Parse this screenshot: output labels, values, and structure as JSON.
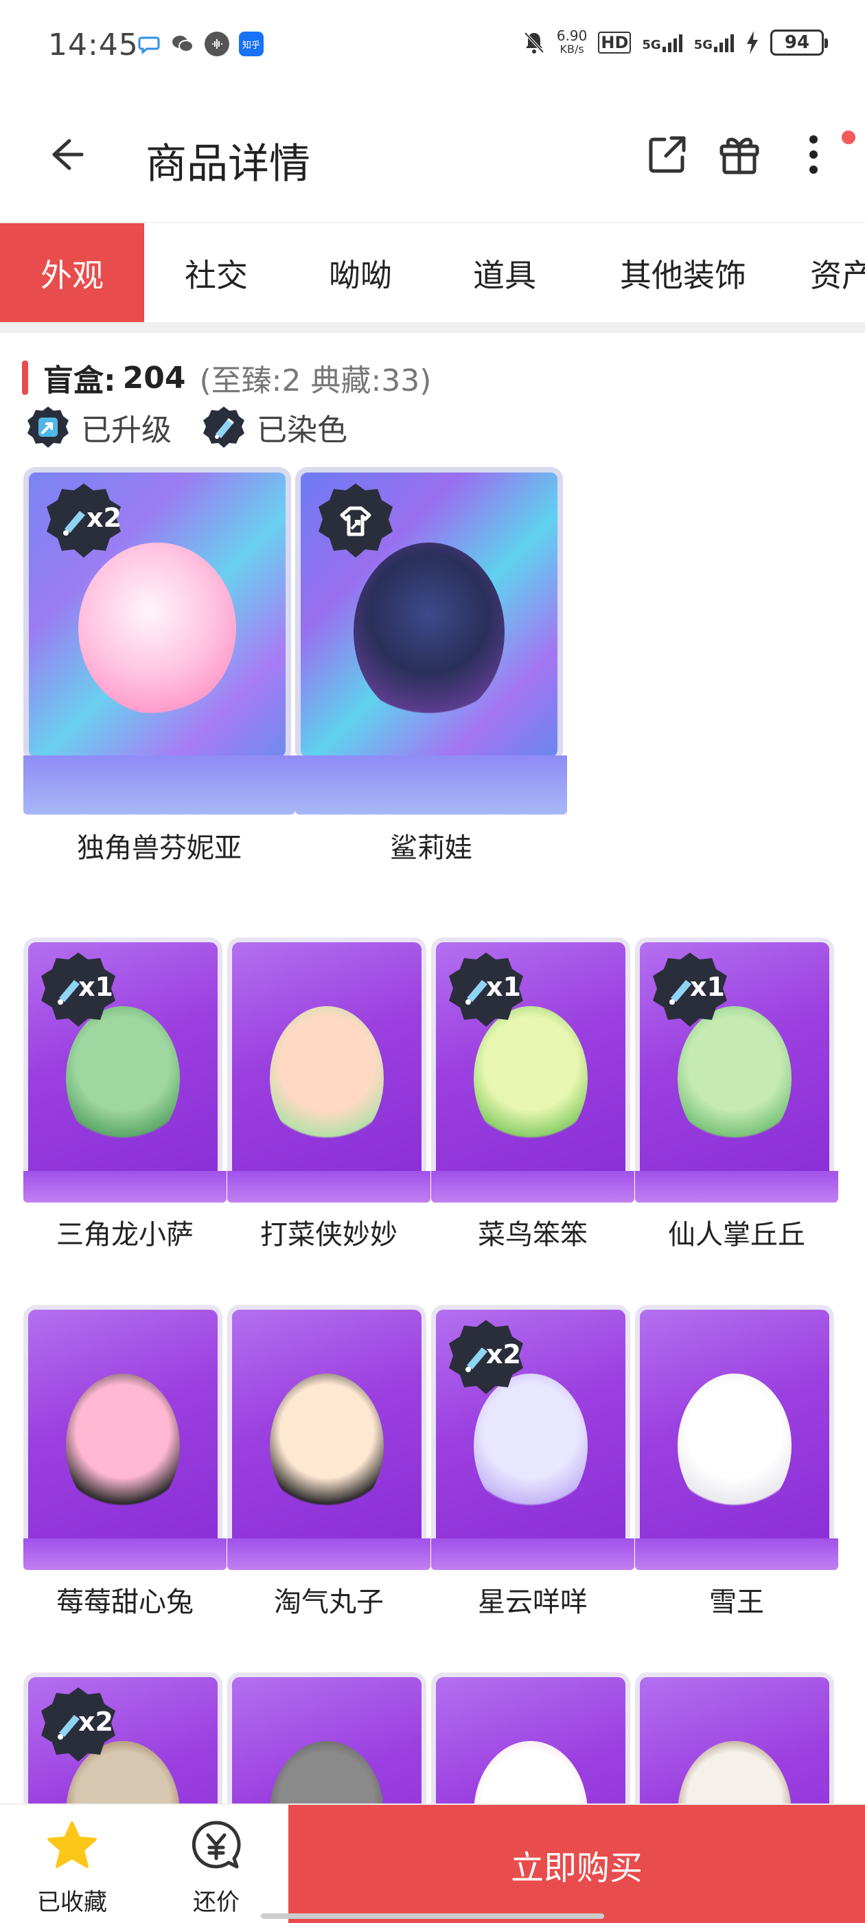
{
  "status_bar": {
    "time": "14:45",
    "net_speed_top": "6.90",
    "net_speed_unit": "KB/s",
    "hd": "HD",
    "sim1": "5G",
    "sim2": "5G",
    "battery": "94",
    "zhihu": "知乎"
  },
  "header": {
    "title": "商品详情"
  },
  "tabs": [
    {
      "label": "外观",
      "active": true
    },
    {
      "label": "社交",
      "active": false
    },
    {
      "label": "呦呦",
      "active": false
    },
    {
      "label": "道具",
      "active": false
    },
    {
      "label": "其他装饰",
      "active": false
    },
    {
      "label": "资产",
      "active": false
    }
  ],
  "section": {
    "title": "盲盒:",
    "count": "204",
    "sub": "(至臻:2 典藏:33)"
  },
  "legend": [
    {
      "label": "已升级",
      "icon": "upgrade-badge-icon"
    },
    {
      "label": "已染色",
      "icon": "dye-badge-icon"
    }
  ],
  "big_items": [
    {
      "name": "独角兽芬妮亚",
      "badge": "x2",
      "badge_type": "dye"
    },
    {
      "name": "鲨莉娃",
      "badge": "",
      "badge_type": "upgrade"
    }
  ],
  "items": [
    {
      "name": "三角龙小萨",
      "badge": "x1"
    },
    {
      "name": "打菜侠妙妙",
      "badge": ""
    },
    {
      "name": "菜鸟笨笨",
      "badge": "x1"
    },
    {
      "name": "仙人掌丘丘",
      "badge": "x1"
    },
    {
      "name": "莓莓甜心兔",
      "badge": ""
    },
    {
      "name": "淘气丸子",
      "badge": ""
    },
    {
      "name": "星云咩咩",
      "badge": "x2"
    },
    {
      "name": "雪王",
      "badge": ""
    },
    {
      "name": "",
      "badge": "x2"
    },
    {
      "name": "",
      "badge": ""
    },
    {
      "name": "",
      "badge": ""
    },
    {
      "name": "",
      "badge": ""
    }
  ],
  "bottom": {
    "favorite_label": "已收藏",
    "bargain_label": "还价",
    "buy_label": "立即购买"
  },
  "colors": {
    "accent": "#e84c4c",
    "purple_box": "#9b3fe0",
    "holo_box": "#7d7ff0"
  }
}
